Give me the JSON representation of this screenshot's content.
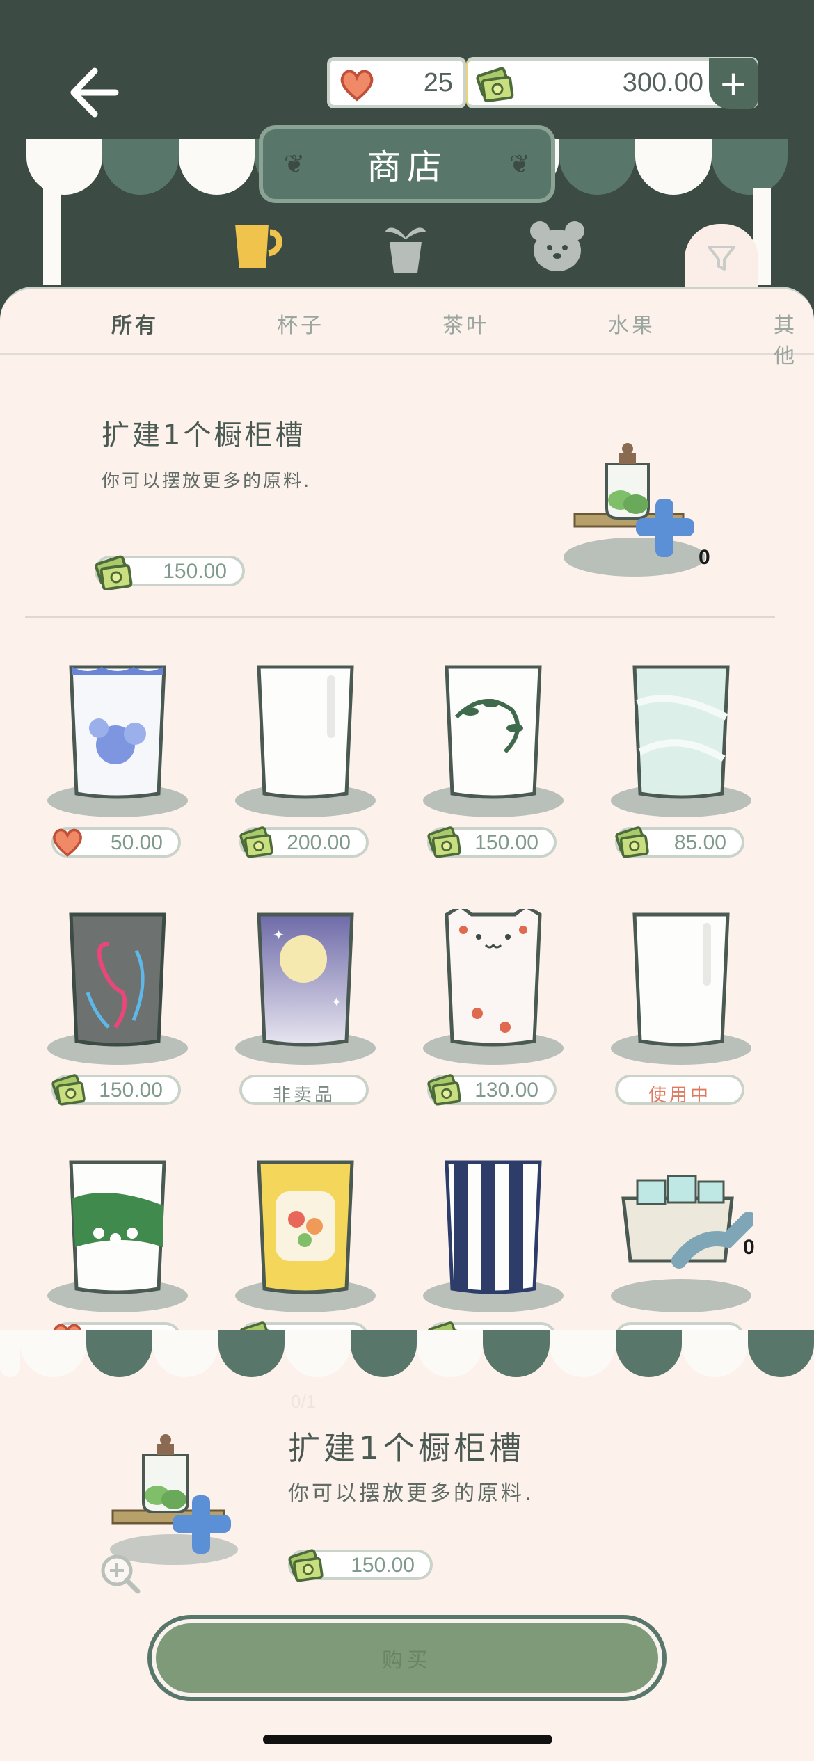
{
  "header": {
    "back_icon": "back-arrow-icon",
    "hearts": "25",
    "money": "300.00",
    "add_icon": "plus-icon",
    "shop_title": "商店"
  },
  "categories": [
    {
      "name": "cup",
      "icon": "mug-icon",
      "active": true
    },
    {
      "name": "plant",
      "icon": "plant-icon",
      "active": false
    },
    {
      "name": "pet",
      "icon": "bear-icon",
      "active": false
    }
  ],
  "filter_icon": "filter-icon",
  "tabs": [
    "所有",
    "杯子",
    "茶叶",
    "水果",
    "其他"
  ],
  "feature": {
    "title": "扩建1个橱柜槽",
    "desc": "你可以摆放更多的原料.",
    "price": "150.00",
    "owned": "0"
  },
  "items": [
    {
      "style": "blue-floral",
      "currency": "heart",
      "price": "50.00"
    },
    {
      "style": "plain-clear",
      "currency": "money",
      "price": "200.00"
    },
    {
      "style": "vine",
      "currency": "money",
      "price": "150.00"
    },
    {
      "style": "marble-mint",
      "currency": "money",
      "price": "85.00"
    },
    {
      "style": "flamingo-neon",
      "currency": "money",
      "price": "150.00"
    },
    {
      "style": "moon-night",
      "currency": "none",
      "price": "非卖品"
    },
    {
      "style": "cat-paw",
      "currency": "money",
      "price": "130.00"
    },
    {
      "style": "plain-clear-2",
      "currency": "none",
      "price": "使用中"
    },
    {
      "style": "lily-green",
      "currency": "heart",
      "price": ""
    },
    {
      "style": "yellow-floral",
      "currency": "money",
      "price": ""
    },
    {
      "style": "navy-stripe",
      "currency": "money",
      "price": ""
    },
    {
      "style": "ice-box",
      "currency": "money",
      "price": "",
      "owned": "0"
    }
  ],
  "bottom": {
    "stock": "0/1",
    "title": "扩建1个橱柜槽",
    "desc": "你可以摆放更多的原料.",
    "price": "150.00",
    "zoom_icon": "zoom-icon",
    "buy_label": "购买"
  },
  "colors": {
    "header_bg": "#3c4c45",
    "accent_green": "#58766a",
    "panel_bg": "#fdf1ec",
    "in_use": "#e07a5f"
  }
}
